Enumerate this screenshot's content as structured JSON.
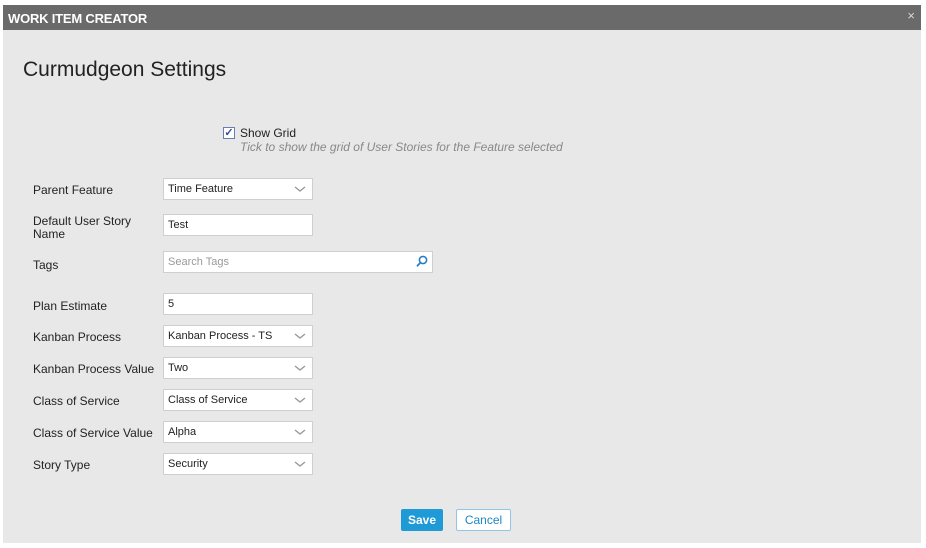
{
  "dialog": {
    "title": "WORK ITEM CREATOR",
    "close_glyph": "×"
  },
  "heading": "Curmudgeon Settings",
  "show_grid": {
    "checked": true,
    "check_glyph": "✓",
    "label": "Show Grid",
    "hint": "Tick to show the grid of User Stories for the Feature selected"
  },
  "form": {
    "parent_feature": {
      "label": "Parent Feature",
      "value": "Time Feature"
    },
    "default_story_name": {
      "label_line1": "Default User Story",
      "label_line2": "Name",
      "value": "Test"
    },
    "tags": {
      "label": "Tags",
      "placeholder": "Search Tags"
    },
    "plan_estimate": {
      "label": "Plan Estimate",
      "value": "5"
    },
    "kanban_process": {
      "label": "Kanban Process",
      "value": "Kanban Process - TS"
    },
    "kanban_process_value": {
      "label": "Kanban Process Value",
      "value": "Two"
    },
    "class_of_service": {
      "label": "Class of Service",
      "value": "Class of Service"
    },
    "class_of_service_value": {
      "label": "Class of Service Value",
      "value": "Alpha"
    },
    "story_type": {
      "label": "Story Type",
      "value": "Security"
    }
  },
  "buttons": {
    "save": "Save",
    "cancel": "Cancel"
  },
  "colors": {
    "titlebar": "#6a6a6a",
    "dialog_bg": "#e8e8e8",
    "primary": "#1e9ad6",
    "icon_accent": "#2a7fc4"
  }
}
